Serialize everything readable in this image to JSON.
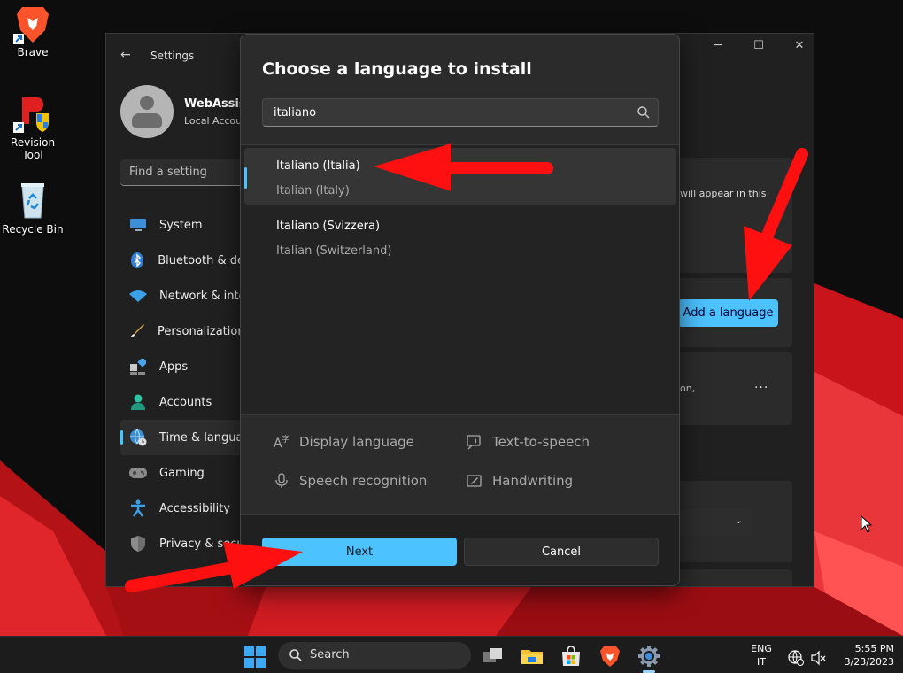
{
  "desktop": {
    "icons": [
      {
        "label": "Brave"
      },
      {
        "label": "Revision Tool"
      },
      {
        "label": "Recycle Bin"
      }
    ]
  },
  "settings": {
    "title": "Settings",
    "user_name": "WebAssist",
    "user_type": "Local Accou",
    "find_placeholder": "Find a setting",
    "nav": [
      {
        "label": "System",
        "icon": "monitor-icon"
      },
      {
        "label": "Bluetooth & de",
        "icon": "bluetooth-icon"
      },
      {
        "label": "Network & inte",
        "icon": "wifi-icon"
      },
      {
        "label": "Personalization",
        "icon": "brush-icon"
      },
      {
        "label": "Apps",
        "icon": "apps-icon"
      },
      {
        "label": "Accounts",
        "icon": "person-icon"
      },
      {
        "label": "Time & langua",
        "icon": "globe-clock-icon",
        "active": true
      },
      {
        "label": "Gaming",
        "icon": "gamepad-icon"
      },
      {
        "label": "Accessibility",
        "icon": "accessibility-icon"
      },
      {
        "label": "Privacy & secu",
        "icon": "shield-icon"
      }
    ],
    "peek": {
      "appear_text": "will appear in this",
      "add_language_label": "Add a language",
      "on_text": "on,",
      "more_label": "···"
    }
  },
  "dialog": {
    "title": "Choose a language to install",
    "search_value": "italiano",
    "languages": [
      {
        "name": "Italiano (Italia)",
        "sub": "Italian (Italy)",
        "selected": true
      },
      {
        "name": "Italiano (Svizzera)",
        "sub": "Italian (Switzerland)",
        "selected": false
      }
    ],
    "features": [
      {
        "label": "Display language",
        "icon": "display-language-icon"
      },
      {
        "label": "Text-to-speech",
        "icon": "text-to-speech-icon"
      },
      {
        "label": "Speech recognition",
        "icon": "microphone-icon"
      },
      {
        "label": "Handwriting",
        "icon": "handwriting-icon"
      }
    ],
    "next_label": "Next",
    "cancel_label": "Cancel"
  },
  "taskbar": {
    "search_label": "Search",
    "lang_top": "ENG",
    "lang_bottom": "IT",
    "time": "5:55 PM",
    "date": "3/23/2023"
  },
  "colors": {
    "accent": "#4cc2ff",
    "arrow": "#ff1010",
    "wallpaper_red": "#c8141a"
  }
}
